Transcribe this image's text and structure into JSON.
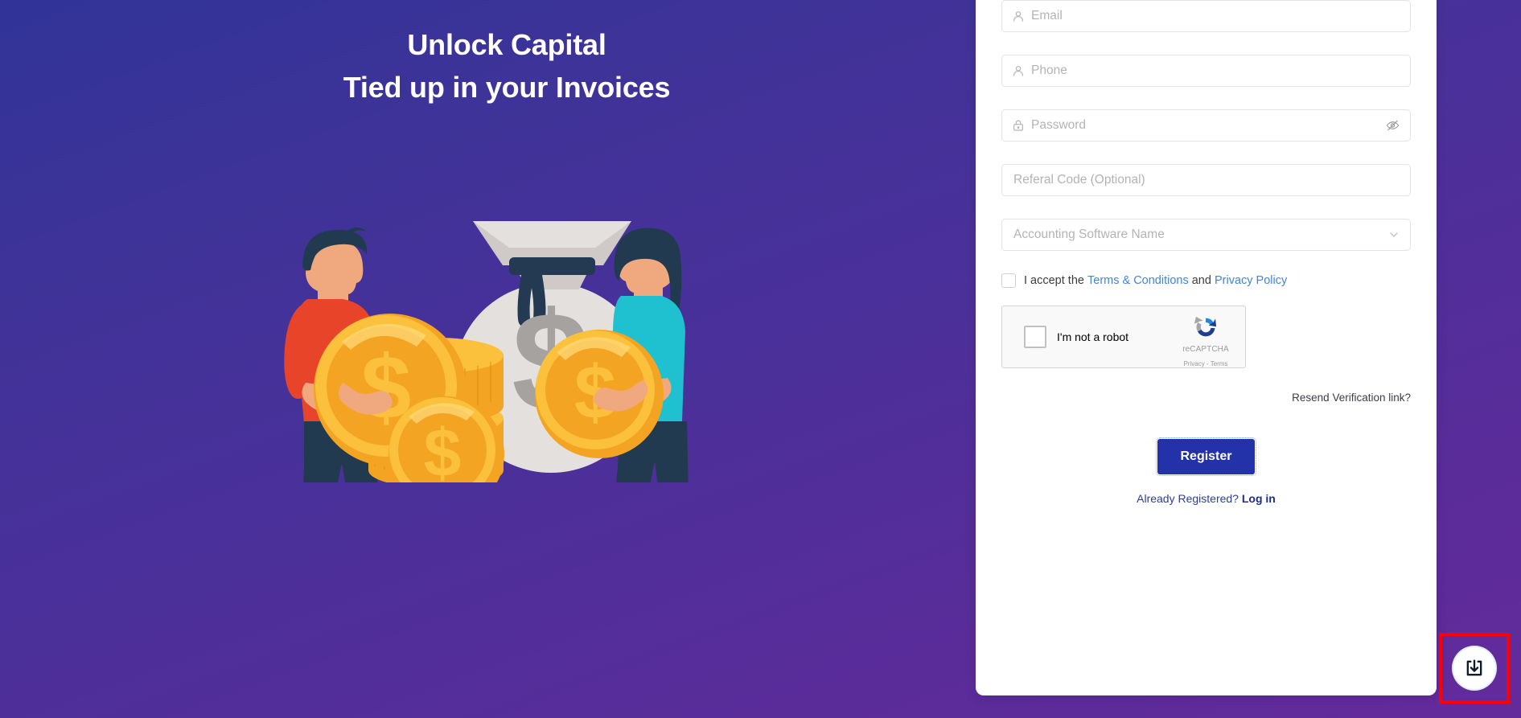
{
  "brand": {
    "bg_gradient_start": "#313398",
    "bg_gradient_end": "#642a9b",
    "accent_button": "#2332a8",
    "link_blue": "#4285d6",
    "highlight_red": "#ff0000"
  },
  "hero": {
    "heading_line1": "Unlock Capital",
    "heading_line2": "Tied up in your Invoices",
    "illustration_name": "people-holding-gold-coins-and-money-bag"
  },
  "form": {
    "fields": [
      {
        "name": "email",
        "placeholder": "Email",
        "icon": "user-icon",
        "value": ""
      },
      {
        "name": "phone",
        "placeholder": "Phone",
        "icon": "user-icon",
        "value": ""
      },
      {
        "name": "password",
        "placeholder": "Password",
        "icon": "lock-icon",
        "value": "",
        "trailing_icon": "eye-slash-icon"
      },
      {
        "name": "referal",
        "placeholder": "Referal Code (Optional)",
        "icon": "",
        "value": ""
      },
      {
        "name": "software",
        "placeholder": "Accounting Software Name",
        "icon": "",
        "value": "",
        "trailing_icon": "chevron-down-icon"
      }
    ],
    "terms": {
      "prefix": "I accept the ",
      "terms_link": "Terms & Conditions",
      "conjunction": " and ",
      "privacy_link": "Privacy Policy",
      "checked": false
    },
    "recaptcha": {
      "label": "I'm not a robot",
      "brand": "reCAPTCHA",
      "privacy": "Privacy",
      "separator": " - ",
      "terms": "Terms",
      "checked": false
    },
    "resend_link": "Resend Verification link?",
    "register_label": "Register",
    "login_prompt": "Already Registered? ",
    "login_link": "Log in"
  },
  "fab": {
    "name": "download-button",
    "icon": "download-icon"
  }
}
